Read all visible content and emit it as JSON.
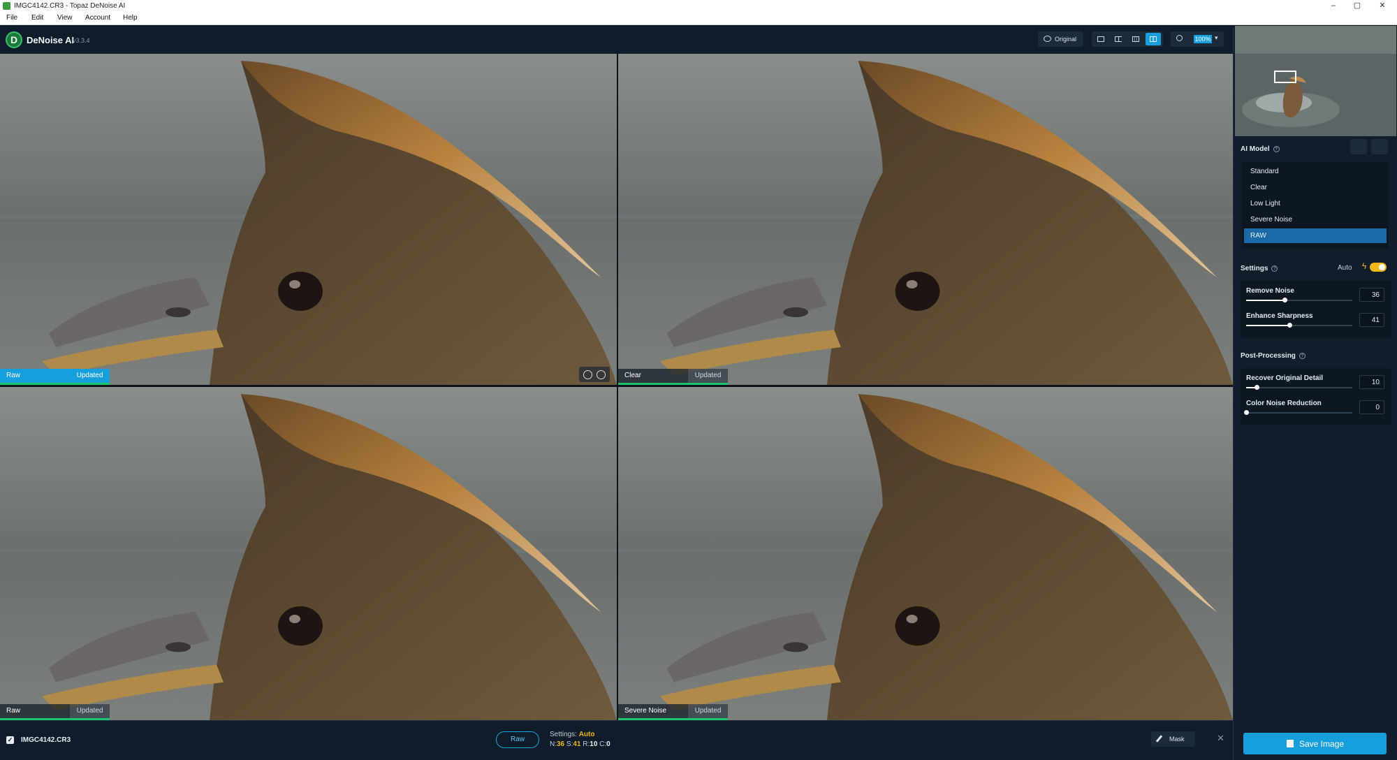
{
  "window": {
    "title": "IMGC4142.CR3 - Topaz DeNoise AI",
    "controls": [
      "–",
      "▢",
      "✕"
    ]
  },
  "menu": [
    "File",
    "Edit",
    "View",
    "Account",
    "Help"
  ],
  "header": {
    "app_name": "DeNoise AI",
    "version": "v3.3.4",
    "original_label": "Original",
    "zoom": "100%"
  },
  "previews": [
    {
      "model": "Raw",
      "status": "Updated"
    },
    {
      "model": "Clear",
      "status": "Updated"
    },
    {
      "model": "Raw",
      "status": "Updated"
    },
    {
      "model": "Severe Noise",
      "status": "Updated"
    }
  ],
  "bottom": {
    "filename": "IMGC4142.CR3",
    "model_button": "Raw",
    "settings_label": "Settings:",
    "settings_mode": "Auto",
    "stats": [
      {
        "key": "N:",
        "value": "36"
      },
      {
        "key": "S:",
        "value": "41"
      },
      {
        "key": "R:",
        "value": "10"
      },
      {
        "key": "C:",
        "value": "0"
      }
    ],
    "mask_label": "Mask"
  },
  "panel": {
    "ai_model_title": "AI Model",
    "models": [
      "Standard",
      "Clear",
      "Low Light",
      "Severe Noise",
      "RAW"
    ],
    "selected_model": "RAW",
    "settings_title": "Settings",
    "auto_label": "Auto",
    "auto_enabled": true,
    "sliders": [
      {
        "label": "Remove Noise",
        "value": "36",
        "level": 0.36
      },
      {
        "label": "Enhance Sharpness",
        "value": "41",
        "level": 0.41
      }
    ],
    "post_title": "Post-Processing",
    "post_sliders": [
      {
        "label": "Recover Original Detail",
        "value": "10",
        "level": 0.1
      },
      {
        "label": "Color Noise Reduction",
        "value": "0",
        "level": 0.0
      }
    ],
    "save_label": "Save Image"
  },
  "colors": {
    "accent": "#169fdc",
    "auto": "#f0b71a",
    "updated_bar": "#1ec46d",
    "background": "#0f1c29"
  }
}
